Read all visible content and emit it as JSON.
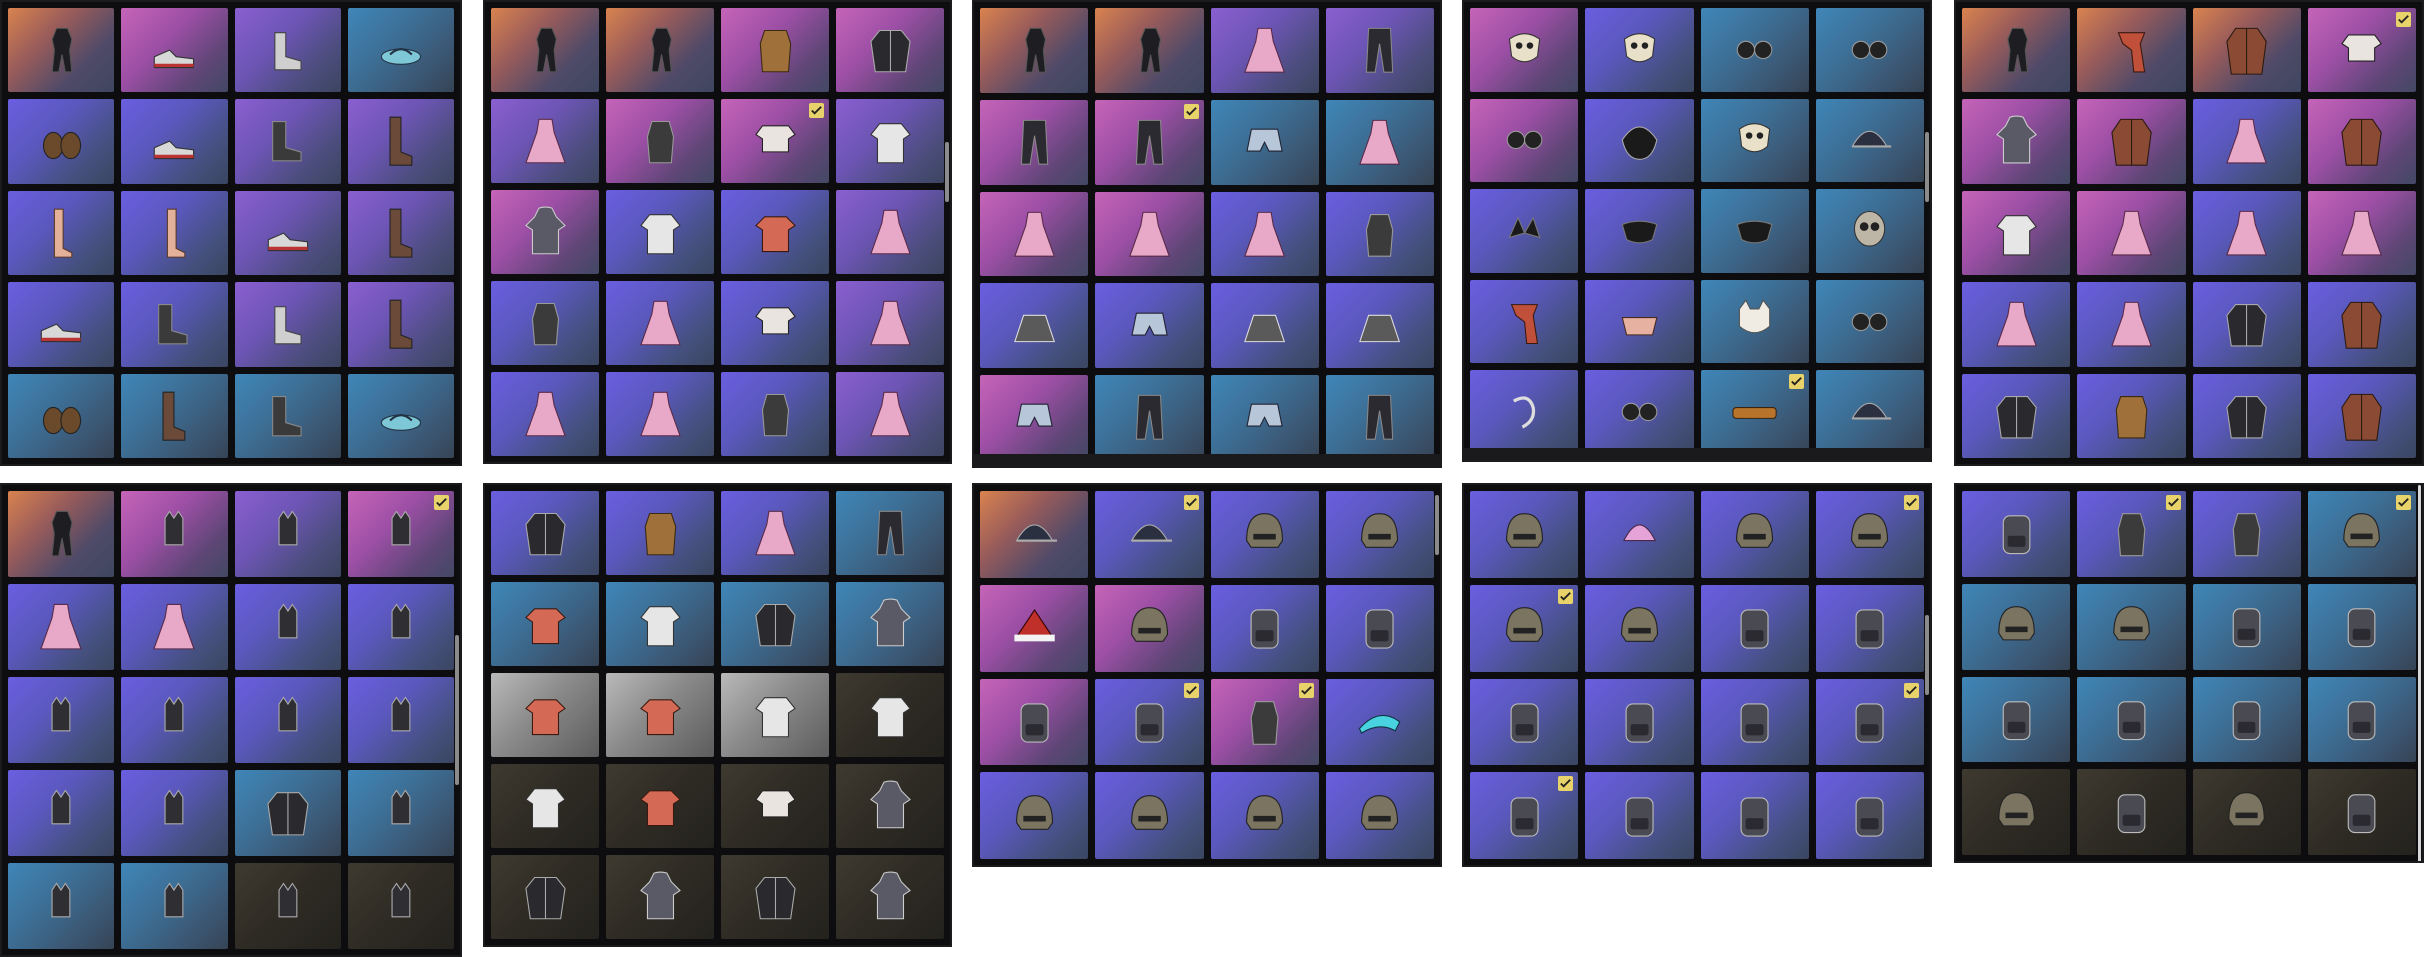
{
  "palette": {
    "panel_bg": "#0d0d0f",
    "owned_check": "#e8d26a",
    "tile_backgrounds": {
      "orange": "#d9834e",
      "pink": "#c564b8",
      "purple": "#8a5fd0",
      "violet": "#6a5ee0",
      "blue": "#3f86b8",
      "gray": "#9a9a9a",
      "dark": "#2e2b24"
    }
  },
  "panels": [
    {
      "name": "shoes-panel",
      "cols": 4,
      "scrollbar": false,
      "tiles": [
        {
          "bg": "orange",
          "icon": "bodysuit-icon"
        },
        {
          "bg": "pink",
          "icon": "sneakers-icon"
        },
        {
          "bg": "purple",
          "icon": "ankle-boots-icon"
        },
        {
          "bg": "blue",
          "icon": "sandals-icon"
        },
        {
          "bg": "violet",
          "icon": "slippers-icon"
        },
        {
          "bg": "violet",
          "icon": "sneakers-icon"
        },
        {
          "bg": "purple",
          "icon": "boots-icon"
        },
        {
          "bg": "purple",
          "icon": "tall-boots-icon"
        },
        {
          "bg": "violet",
          "icon": "stockings-icon"
        },
        {
          "bg": "violet",
          "icon": "stockings-icon"
        },
        {
          "bg": "purple",
          "icon": "sneakers-icon"
        },
        {
          "bg": "purple",
          "icon": "tall-boots-icon"
        },
        {
          "bg": "violet",
          "icon": "sneakers-icon"
        },
        {
          "bg": "violet",
          "icon": "boots-icon"
        },
        {
          "bg": "purple",
          "icon": "ankle-boots-icon"
        },
        {
          "bg": "purple",
          "icon": "tall-boots-icon"
        },
        {
          "bg": "blue",
          "icon": "slippers-icon"
        },
        {
          "bg": "blue",
          "icon": "tall-boots-icon"
        },
        {
          "bg": "blue",
          "icon": "boots-icon"
        },
        {
          "bg": "blue",
          "icon": "sandals-icon"
        }
      ]
    },
    {
      "name": "outfits-panel-1",
      "cols": 4,
      "scrollbar": true,
      "tiles": [
        {
          "bg": "orange",
          "icon": "bodysuit-icon"
        },
        {
          "bg": "orange",
          "icon": "bodysuit-icon"
        },
        {
          "bg": "pink",
          "icon": "fur-vest-icon"
        },
        {
          "bg": "pink",
          "icon": "jacket-icon"
        },
        {
          "bg": "purple",
          "icon": "dress-icon"
        },
        {
          "bg": "pink",
          "icon": "vest-icon"
        },
        {
          "bg": "pink",
          "icon": "crop-top-icon",
          "owned": true
        },
        {
          "bg": "purple",
          "icon": "shirt-icon"
        },
        {
          "bg": "pink",
          "icon": "hoodie-icon"
        },
        {
          "bg": "violet",
          "icon": "shirt-icon"
        },
        {
          "bg": "violet",
          "icon": "tshirt-icon"
        },
        {
          "bg": "purple",
          "icon": "dress-icon"
        },
        {
          "bg": "violet",
          "icon": "vest-icon"
        },
        {
          "bg": "violet",
          "icon": "dress-icon"
        },
        {
          "bg": "violet",
          "icon": "crop-top-icon"
        },
        {
          "bg": "purple",
          "icon": "dress-icon"
        },
        {
          "bg": "violet",
          "icon": "dress-icon"
        },
        {
          "bg": "violet",
          "icon": "dress-icon"
        },
        {
          "bg": "violet",
          "icon": "vest-icon"
        },
        {
          "bg": "purple",
          "icon": "dress-icon"
        }
      ]
    },
    {
      "name": "bottoms-panel",
      "cols": 4,
      "scrollbar": false,
      "tiles": [
        {
          "bg": "orange",
          "icon": "bodysuit-icon"
        },
        {
          "bg": "orange",
          "icon": "bodysuit-icon"
        },
        {
          "bg": "purple",
          "icon": "dress-icon"
        },
        {
          "bg": "purple",
          "icon": "pants-icon"
        },
        {
          "bg": "pink",
          "icon": "pants-icon"
        },
        {
          "bg": "pink",
          "icon": "pants-icon",
          "owned": true
        },
        {
          "bg": "blue",
          "icon": "shorts-icon"
        },
        {
          "bg": "blue",
          "icon": "dress-icon"
        },
        {
          "bg": "pink",
          "icon": "dress-icon"
        },
        {
          "bg": "pink",
          "icon": "dress-icon"
        },
        {
          "bg": "violet",
          "icon": "dress-icon"
        },
        {
          "bg": "violet",
          "icon": "vest-icon"
        },
        {
          "bg": "violet",
          "icon": "skirt-icon"
        },
        {
          "bg": "violet",
          "icon": "shorts-icon"
        },
        {
          "bg": "violet",
          "icon": "skirt-icon"
        },
        {
          "bg": "violet",
          "icon": "skirt-icon"
        },
        {
          "bg": "pink",
          "icon": "shorts-icon"
        },
        {
          "bg": "blue",
          "icon": "pants-icon"
        },
        {
          "bg": "blue",
          "icon": "shorts-icon"
        },
        {
          "bg": "blue",
          "icon": "pants-icon"
        }
      ]
    },
    {
      "name": "accessories-panel",
      "cols": 4,
      "scrollbar": true,
      "tiles": [
        {
          "bg": "pink",
          "icon": "mask-icon"
        },
        {
          "bg": "violet",
          "icon": "mask-icon"
        },
        {
          "bg": "blue",
          "icon": "glasses-icon"
        },
        {
          "bg": "blue",
          "icon": "glasses-icon"
        },
        {
          "bg": "pink",
          "icon": "glasses-icon"
        },
        {
          "bg": "violet",
          "icon": "hair-icon"
        },
        {
          "bg": "blue",
          "icon": "mask-icon"
        },
        {
          "bg": "blue",
          "icon": "cap-icon"
        },
        {
          "bg": "violet",
          "icon": "ears-icon"
        },
        {
          "bg": "violet",
          "icon": "face-mask-icon"
        },
        {
          "bg": "blue",
          "icon": "face-mask-icon"
        },
        {
          "bg": "blue",
          "icon": "skull-mask-icon"
        },
        {
          "bg": "violet",
          "icon": "scarf-icon"
        },
        {
          "bg": "violet",
          "icon": "bag-icon"
        },
        {
          "bg": "blue",
          "icon": "cat-mask-icon"
        },
        {
          "bg": "blue",
          "icon": "glasses-icon"
        },
        {
          "bg": "violet",
          "icon": "hook-icon"
        },
        {
          "bg": "violet",
          "icon": "glasses-icon"
        },
        {
          "bg": "blue",
          "icon": "belt-icon",
          "owned": true
        },
        {
          "bg": "blue",
          "icon": "cap-icon"
        }
      ]
    },
    {
      "name": "outfits-panel-2",
      "cols": 4,
      "scrollbar": false,
      "tiles": [
        {
          "bg": "orange",
          "icon": "bodysuit-icon"
        },
        {
          "bg": "orange",
          "icon": "scarf-icon"
        },
        {
          "bg": "orange",
          "icon": "coat-icon"
        },
        {
          "bg": "pink",
          "icon": "crop-top-icon",
          "owned": true
        },
        {
          "bg": "pink",
          "icon": "hoodie-icon"
        },
        {
          "bg": "pink",
          "icon": "coat-icon"
        },
        {
          "bg": "violet",
          "icon": "dress-icon"
        },
        {
          "bg": "pink",
          "icon": "coat-icon"
        },
        {
          "bg": "pink",
          "icon": "shirt-icon"
        },
        {
          "bg": "pink",
          "icon": "dress-icon"
        },
        {
          "bg": "violet",
          "icon": "dress-icon"
        },
        {
          "bg": "pink",
          "icon": "dress-icon"
        },
        {
          "bg": "violet",
          "icon": "dress-icon"
        },
        {
          "bg": "violet",
          "icon": "dress-icon"
        },
        {
          "bg": "violet",
          "icon": "jacket-icon"
        },
        {
          "bg": "violet",
          "icon": "coat-icon"
        },
        {
          "bg": "violet",
          "icon": "jacket-icon"
        },
        {
          "bg": "violet",
          "icon": "fur-vest-icon"
        },
        {
          "bg": "violet",
          "icon": "jacket-icon"
        },
        {
          "bg": "violet",
          "icon": "coat-icon"
        }
      ]
    },
    {
      "name": "gloves-panel",
      "cols": 4,
      "scrollbar": true,
      "tiles": [
        {
          "bg": "orange",
          "icon": "bodysuit-icon"
        },
        {
          "bg": "pink",
          "icon": "gloves-icon"
        },
        {
          "bg": "purple",
          "icon": "gloves-icon"
        },
        {
          "bg": "pink",
          "icon": "gloves-icon",
          "owned": true
        },
        {
          "bg": "violet",
          "icon": "dress-icon"
        },
        {
          "bg": "violet",
          "icon": "dress-icon"
        },
        {
          "bg": "violet",
          "icon": "gloves-icon"
        },
        {
          "bg": "violet",
          "icon": "gloves-icon"
        },
        {
          "bg": "violet",
          "icon": "gloves-icon"
        },
        {
          "bg": "violet",
          "icon": "gloves-icon"
        },
        {
          "bg": "violet",
          "icon": "gloves-icon"
        },
        {
          "bg": "violet",
          "icon": "gloves-icon"
        },
        {
          "bg": "violet",
          "icon": "gloves-icon"
        },
        {
          "bg": "violet",
          "icon": "gloves-icon"
        },
        {
          "bg": "blue",
          "icon": "jacket-icon"
        },
        {
          "bg": "blue",
          "icon": "gloves-icon"
        },
        {
          "bg": "blue",
          "icon": "gloves-icon"
        },
        {
          "bg": "blue",
          "icon": "gloves-icon"
        },
        {
          "bg": "dark",
          "icon": "gloves-icon"
        },
        {
          "bg": "dark",
          "icon": "gloves-icon"
        }
      ]
    },
    {
      "name": "tops-panel",
      "cols": 4,
      "scrollbar": false,
      "tiles": [
        {
          "bg": "violet",
          "icon": "jacket-icon"
        },
        {
          "bg": "violet",
          "icon": "fur-vest-icon"
        },
        {
          "bg": "violet",
          "icon": "dress-icon"
        },
        {
          "bg": "blue",
          "icon": "pants-icon"
        },
        {
          "bg": "blue",
          "icon": "tshirt-icon"
        },
        {
          "bg": "blue",
          "icon": "shirt-icon"
        },
        {
          "bg": "blue",
          "icon": "jacket-icon"
        },
        {
          "bg": "blue",
          "icon": "hoodie-icon"
        },
        {
          "bg": "gray",
          "icon": "tshirt-icon"
        },
        {
          "bg": "gray",
          "icon": "tshirt-icon"
        },
        {
          "bg": "gray",
          "icon": "shirt-icon"
        },
        {
          "bg": "dark",
          "icon": "shirt-icon"
        },
        {
          "bg": "dark",
          "icon": "shirt-icon"
        },
        {
          "bg": "dark",
          "icon": "tshirt-icon"
        },
        {
          "bg": "dark",
          "icon": "crop-top-icon"
        },
        {
          "bg": "dark",
          "icon": "hoodie-icon"
        },
        {
          "bg": "dark",
          "icon": "jacket-icon"
        },
        {
          "bg": "dark",
          "icon": "hoodie-icon"
        },
        {
          "bg": "dark",
          "icon": "jacket-icon"
        },
        {
          "bg": "dark",
          "icon": "hoodie-icon"
        }
      ]
    },
    {
      "name": "headwear-panel-1",
      "cols": 4,
      "scrollbar": true,
      "tiles": [
        {
          "bg": "orange",
          "icon": "cap-icon"
        },
        {
          "bg": "violet",
          "icon": "cap-icon",
          "owned": true
        },
        {
          "bg": "violet",
          "icon": "helmet-icon"
        },
        {
          "bg": "violet",
          "icon": "helmet-icon"
        },
        {
          "bg": "pink",
          "icon": "santa-hat-icon"
        },
        {
          "bg": "pink",
          "icon": "helmet-icon"
        },
        {
          "bg": "violet",
          "icon": "backpack-icon"
        },
        {
          "bg": "violet",
          "icon": "backpack-icon"
        },
        {
          "bg": "pink",
          "icon": "backpack-icon"
        },
        {
          "bg": "violet",
          "icon": "backpack-icon",
          "owned": true
        },
        {
          "bg": "pink",
          "icon": "vest-icon",
          "owned": true
        },
        {
          "bg": "violet",
          "icon": "visor-icon"
        },
        {
          "bg": "violet",
          "icon": "helmet-icon"
        },
        {
          "bg": "violet",
          "icon": "helmet-icon"
        },
        {
          "bg": "violet",
          "icon": "helmet-icon"
        },
        {
          "bg": "violet",
          "icon": "helmet-icon"
        }
      ]
    },
    {
      "name": "headwear-panel-2",
      "cols": 4,
      "scrollbar": true,
      "tiles": [
        {
          "bg": "violet",
          "icon": "helmet-icon"
        },
        {
          "bg": "violet",
          "icon": "hat-icon"
        },
        {
          "bg": "violet",
          "icon": "helmet-icon"
        },
        {
          "bg": "violet",
          "icon": "helmet-icon",
          "owned": true
        },
        {
          "bg": "violet",
          "icon": "helmet-icon",
          "owned": true
        },
        {
          "bg": "violet",
          "icon": "helmet-icon"
        },
        {
          "bg": "violet",
          "icon": "backpack-icon"
        },
        {
          "bg": "violet",
          "icon": "backpack-icon"
        },
        {
          "bg": "violet",
          "icon": "backpack-icon"
        },
        {
          "bg": "violet",
          "icon": "backpack-icon"
        },
        {
          "bg": "violet",
          "icon": "backpack-icon"
        },
        {
          "bg": "violet",
          "icon": "backpack-icon",
          "owned": true
        },
        {
          "bg": "violet",
          "icon": "backpack-icon",
          "owned": true
        },
        {
          "bg": "violet",
          "icon": "backpack-icon"
        },
        {
          "bg": "violet",
          "icon": "backpack-icon"
        },
        {
          "bg": "violet",
          "icon": "backpack-icon"
        }
      ]
    },
    {
      "name": "backpacks-panel",
      "cols": 4,
      "scrollbar": true,
      "tiles": [
        {
          "bg": "violet",
          "icon": "backpack-icon"
        },
        {
          "bg": "violet",
          "icon": "vest-icon",
          "owned": true
        },
        {
          "bg": "violet",
          "icon": "vest-icon"
        },
        {
          "bg": "blue",
          "icon": "helmet-icon",
          "owned": true
        },
        {
          "bg": "blue",
          "icon": "helmet-icon"
        },
        {
          "bg": "blue",
          "icon": "helmet-icon"
        },
        {
          "bg": "blue",
          "icon": "backpack-icon"
        },
        {
          "bg": "blue",
          "icon": "backpack-icon"
        },
        {
          "bg": "blue",
          "icon": "backpack-icon"
        },
        {
          "bg": "blue",
          "icon": "backpack-icon"
        },
        {
          "bg": "blue",
          "icon": "backpack-icon"
        },
        {
          "bg": "blue",
          "icon": "backpack-icon"
        },
        {
          "bg": "dark",
          "icon": "helmet-icon"
        },
        {
          "bg": "dark",
          "icon": "backpack-icon"
        },
        {
          "bg": "dark",
          "icon": "helmet-icon"
        },
        {
          "bg": "dark",
          "icon": "backpack-icon"
        }
      ]
    }
  ]
}
